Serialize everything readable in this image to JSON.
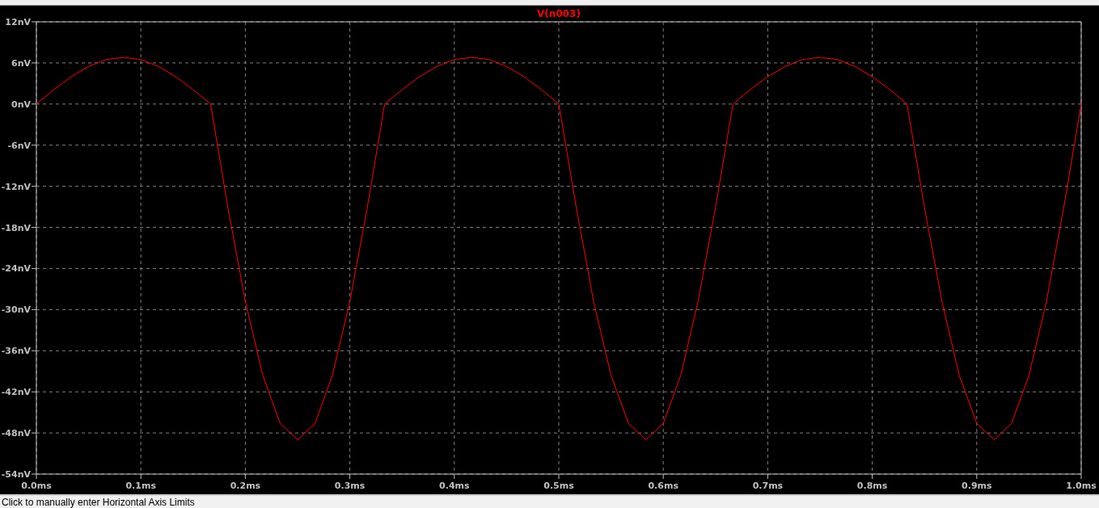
{
  "plot": {
    "chart_data": {
      "type": "line",
      "x": [
        0,
        0.0167,
        0.0333,
        0.05,
        0.0667,
        0.0833,
        0.1,
        0.1167,
        0.1333,
        0.15,
        0.1667,
        0.1833,
        0.2,
        0.2167,
        0.2333,
        0.25,
        0.2667,
        0.2833,
        0.3,
        0.3167,
        0.3333,
        0.35,
        0.3667,
        0.3833,
        0.4,
        0.4167,
        0.4333,
        0.45,
        0.4667,
        0.4833,
        0.5,
        0.5167,
        0.5333,
        0.55,
        0.5667,
        0.5833,
        0.6,
        0.6167,
        0.6333,
        0.65,
        0.6667,
        0.6833,
        0.7,
        0.7167,
        0.7333,
        0.75,
        0.7667,
        0.7833,
        0.8,
        0.8167,
        0.8333,
        0.85,
        0.8667,
        0.8833,
        0.9,
        0.9167,
        0.9333,
        0.95,
        0.9667,
        0.9833,
        1.0
      ],
      "series": [
        {
          "name": "V(n003)",
          "color": "#ff0000",
          "values": [
            0,
            2.1,
            4,
            5.5,
            6.5,
            6.8,
            6.5,
            5.5,
            4,
            2.1,
            0,
            -15.1,
            -28.8,
            -39.6,
            -46.6,
            -49,
            -46.6,
            -39.6,
            -28.8,
            -15.1,
            0,
            2.1,
            4,
            5.5,
            6.5,
            6.8,
            6.5,
            5.5,
            4,
            2.1,
            0,
            -15.1,
            -28.8,
            -39.6,
            -46.6,
            -49,
            -46.6,
            -39.6,
            -28.8,
            -15.1,
            0,
            2.1,
            4,
            5.5,
            6.5,
            6.8,
            6.5,
            5.5,
            4,
            2.1,
            0,
            -15.1,
            -28.8,
            -39.6,
            -46.6,
            -49,
            -46.6,
            -39.6,
            -28.8,
            -15.1,
            0
          ]
        }
      ],
      "grid": true,
      "xlim": [
        0,
        1
      ],
      "ylim": [
        -54,
        12
      ],
      "xticks": [
        {
          "value": 0,
          "label": "0.0ms"
        },
        {
          "value": 0.1,
          "label": "0.1ms"
        },
        {
          "value": 0.2,
          "label": "0.2ms"
        },
        {
          "value": 0.3,
          "label": "0.3ms"
        },
        {
          "value": 0.4,
          "label": "0.4ms"
        },
        {
          "value": 0.5,
          "label": "0.5ms"
        },
        {
          "value": 0.6,
          "label": "0.6ms"
        },
        {
          "value": 0.7,
          "label": "0.7ms"
        },
        {
          "value": 0.8,
          "label": "0.8ms"
        },
        {
          "value": 0.9,
          "label": "0.9ms"
        },
        {
          "value": 1,
          "label": "1.0ms"
        }
      ],
      "yticks": [
        {
          "value": 12,
          "label": "12nV"
        },
        {
          "value": 6,
          "label": "6nV"
        },
        {
          "value": 0,
          "label": "0nV"
        },
        {
          "value": -6,
          "label": "-6nV"
        },
        {
          "value": -12,
          "label": "-12nV"
        },
        {
          "value": -18,
          "label": "-18nV"
        },
        {
          "value": -24,
          "label": "-24nV"
        },
        {
          "value": -30,
          "label": "-30nV"
        },
        {
          "value": -36,
          "label": "-36nV"
        },
        {
          "value": -42,
          "label": "-42nV"
        },
        {
          "value": -48,
          "label": "-48nV"
        },
        {
          "value": -54,
          "label": "-54nV"
        }
      ]
    }
  },
  "status_bar": {
    "text": "Click to manually enter Horizontal Axis Limits"
  }
}
